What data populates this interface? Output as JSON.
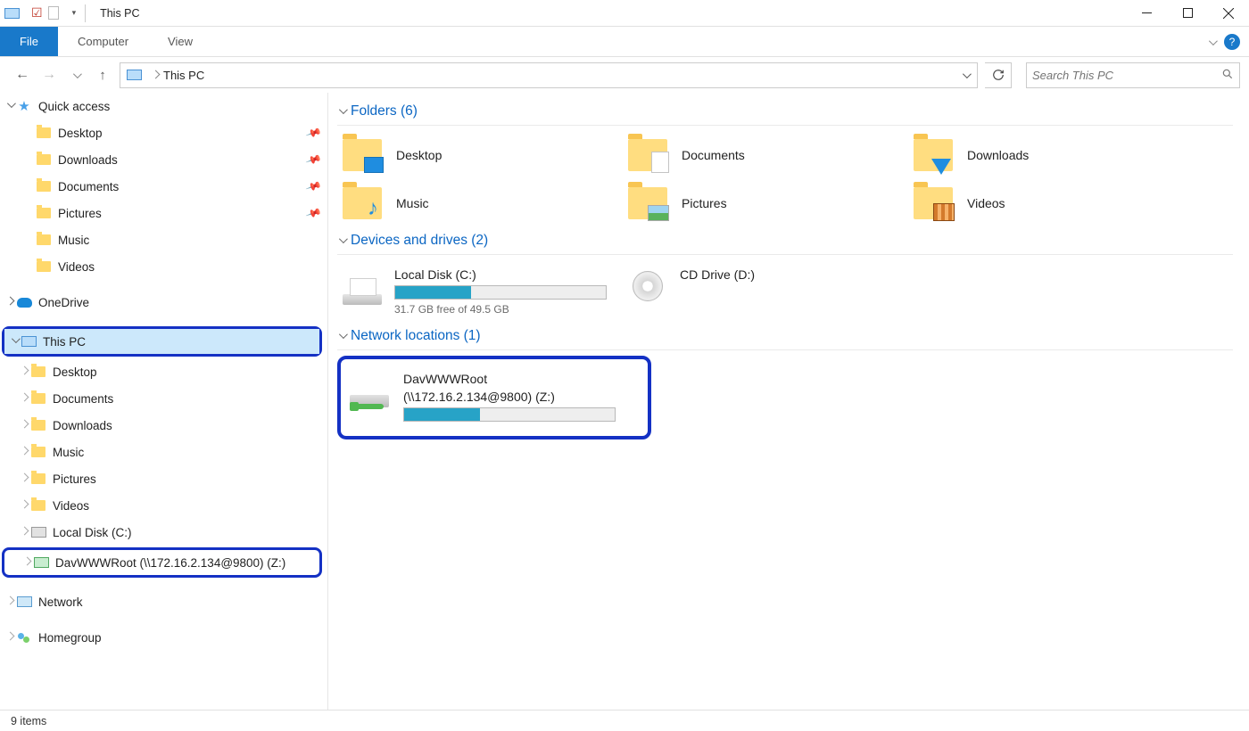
{
  "window": {
    "title": "This PC"
  },
  "ribbon": {
    "file": "File",
    "tabs": [
      "Computer",
      "View"
    ]
  },
  "address": {
    "crumb": "This PC",
    "search_placeholder": "Search This PC"
  },
  "sidebar": {
    "quick_access": {
      "label": "Quick access",
      "items": [
        {
          "label": "Desktop",
          "pinned": true
        },
        {
          "label": "Downloads",
          "pinned": true
        },
        {
          "label": "Documents",
          "pinned": true
        },
        {
          "label": "Pictures",
          "pinned": true
        },
        {
          "label": "Music",
          "pinned": false
        },
        {
          "label": "Videos",
          "pinned": false
        }
      ]
    },
    "onedrive": {
      "label": "OneDrive"
    },
    "this_pc": {
      "label": "This PC",
      "children": [
        {
          "label": "Desktop"
        },
        {
          "label": "Documents"
        },
        {
          "label": "Downloads"
        },
        {
          "label": "Music"
        },
        {
          "label": "Pictures"
        },
        {
          "label": "Videos"
        },
        {
          "label": "Local Disk (C:)"
        },
        {
          "label": "DavWWWRoot (\\\\172.16.2.134@9800) (Z:)"
        }
      ]
    },
    "network": {
      "label": "Network"
    },
    "homegroup": {
      "label": "Homegroup"
    }
  },
  "content": {
    "folders": {
      "heading": "Folders (6)",
      "items": [
        {
          "label": "Desktop",
          "overlay_color": "#1f8de0"
        },
        {
          "label": "Documents",
          "overlay_color": "#ffffff"
        },
        {
          "label": "Downloads",
          "overlay_color": "#1f8de0"
        },
        {
          "label": "Music",
          "overlay_color": "#1f8de0"
        },
        {
          "label": "Pictures",
          "overlay_color": "#59b25c"
        },
        {
          "label": "Videos",
          "overlay_color": "#d47a2c"
        }
      ]
    },
    "drives": {
      "heading": "Devices and drives (2)",
      "local": {
        "name": "Local Disk (C:)",
        "free_text": "31.7 GB free of 49.5 GB",
        "fill_pct": 36
      },
      "cd": {
        "name": "CD Drive (D:)"
      }
    },
    "network_loc": {
      "heading": "Network locations (1)",
      "item": {
        "name": "DavWWWRoot",
        "sub": "(\\\\172.16.2.134@9800) (Z:)",
        "fill_pct": 36
      }
    }
  },
  "statusbar": {
    "text": "9 items"
  }
}
